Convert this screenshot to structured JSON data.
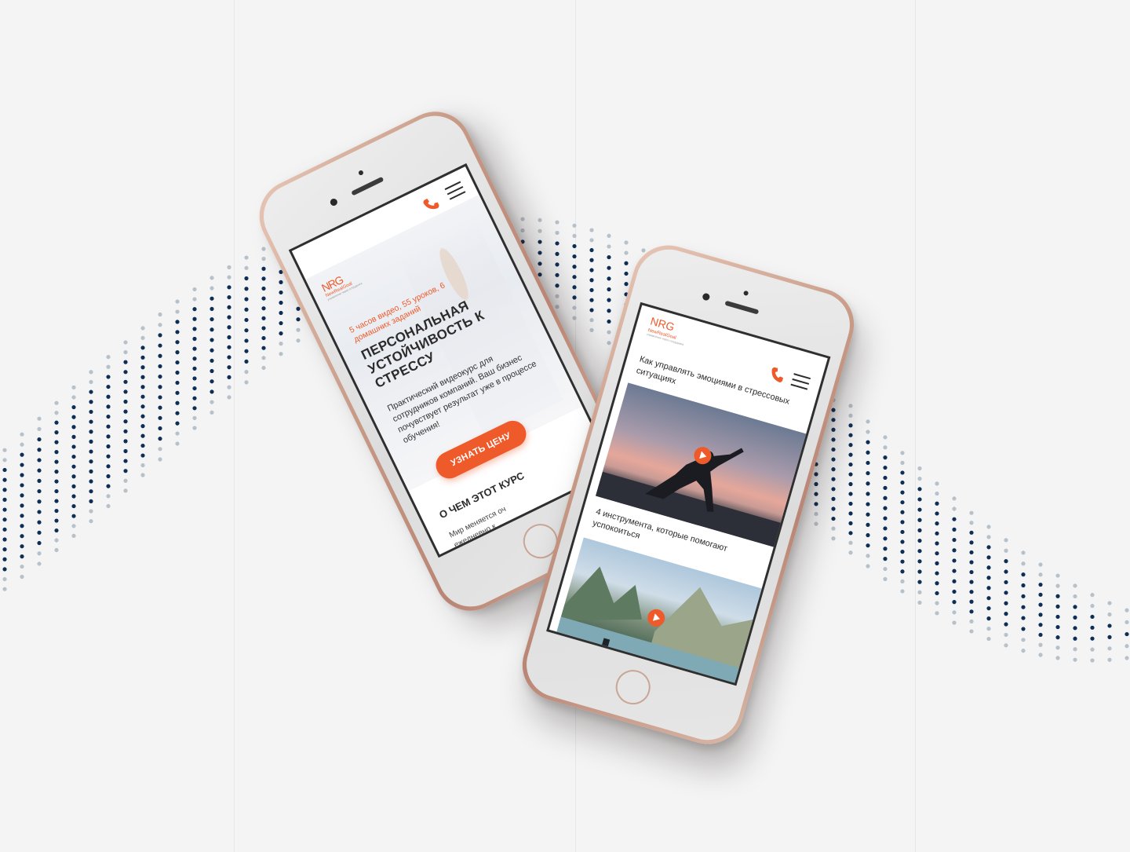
{
  "colors": {
    "background": "#f4f4f5",
    "accent": "#ef5a2b",
    "wave_dark": "#0f2e55",
    "wave_light": "#b7c1ca",
    "phone_gold": "#c79a86"
  },
  "icons": {
    "phone": "phone-icon",
    "menu": "hamburger-menu-icon",
    "play": "play-icon"
  },
  "phone1": {
    "logo": {
      "mark": "NRG",
      "brand": "NewRealGoal",
      "tagline": "управление через сотрудника"
    },
    "subtitle": "5 часов видео, 55 уроков, 6 домашних заданий",
    "headline": "ПЕРСОНАЛЬНАЯ УСТОЙЧИВОСТЬ К СТРЕССУ",
    "description": "Практический видеокурс для сотрудников компаний. Ваш бизнес почувствует результат уже в процессе обучения!",
    "cta_label": "УЗНАТЬ ЦЕНУ",
    "section_title": "О ЧЕМ ЭТОТ КУРС",
    "section_text_line1": "Мир меняется оч",
    "section_text_line2": "ежедневно к"
  },
  "phone2": {
    "logo": {
      "mark": "NRG",
      "brand": "NewRealGoal",
      "tagline": "управление через сотрудника"
    },
    "video1_title": "Как управлять эмоциями в стрессовых ситуациях",
    "video2_title": "4 инструмента, которые помогают успокоиться"
  }
}
